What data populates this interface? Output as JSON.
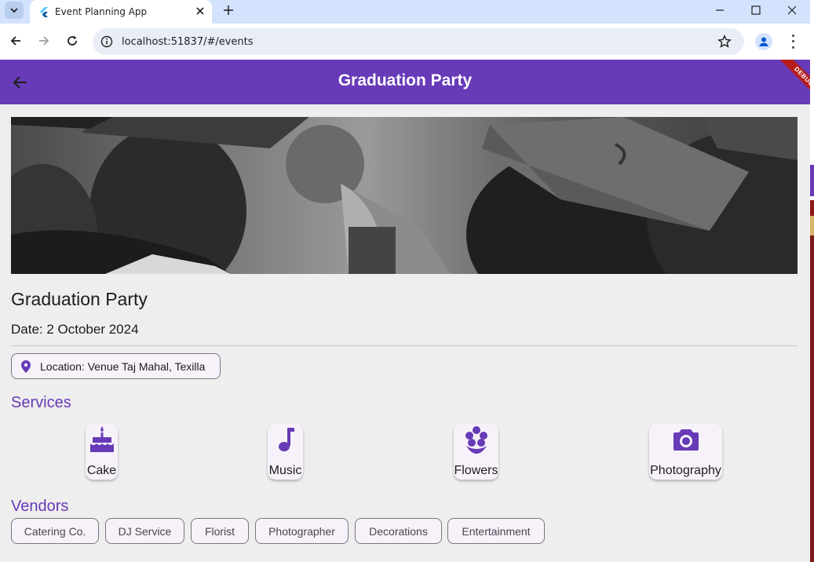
{
  "browser": {
    "tab_title": "Event Planning App",
    "url": "localhost:51837/#/events"
  },
  "app": {
    "title": "Graduation Party",
    "debug_label": "DEBUG",
    "accent_color": "#673ab7"
  },
  "event": {
    "name": "Graduation Party",
    "date": "Date: 2 October 2024",
    "location": "Location: Venue Taj Mahal, Texilla"
  },
  "services": {
    "heading": "Services",
    "items": [
      {
        "label": "Cake",
        "icon": "cake-icon"
      },
      {
        "label": "Music",
        "icon": "music-note-icon"
      },
      {
        "label": "Flowers",
        "icon": "flower-icon"
      },
      {
        "label": "Photography",
        "icon": "camera-icon"
      }
    ]
  },
  "vendors": {
    "heading": "Vendors",
    "items": [
      "Catering Co.",
      "DJ Service",
      "Florist",
      "Photographer",
      "Decorations",
      "Entertainment"
    ]
  }
}
